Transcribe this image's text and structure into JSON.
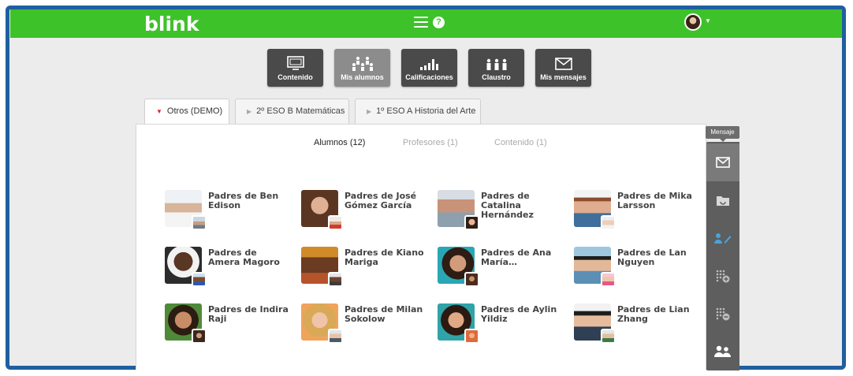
{
  "app": {
    "logo": "blink"
  },
  "nav": {
    "buttons": [
      {
        "label": "Contenido",
        "icon": "monitor-icon",
        "active": false
      },
      {
        "label": "Mis alumnos",
        "icon": "students-icon",
        "active": true
      },
      {
        "label": "Calificaciones",
        "icon": "bar-chart-icon",
        "active": false
      },
      {
        "label": "Claustro",
        "icon": "staff-icon",
        "active": false
      },
      {
        "label": "Mis mensajes",
        "icon": "envelope-icon",
        "active": false
      }
    ]
  },
  "class_tabs": [
    {
      "label": "Otros (DEMO)",
      "active": true
    },
    {
      "label": "2º ESO B Matemáticas",
      "active": false
    },
    {
      "label": "1º ESO A Historia del Arte",
      "active": false
    }
  ],
  "subtabs": [
    {
      "label": "Alumnos (12)",
      "active": true
    },
    {
      "label": "Profesores (1)",
      "active": false
    },
    {
      "label": "Contenido (1)",
      "active": false
    }
  ],
  "contacts": [
    {
      "name": "Padres de Ben Edison"
    },
    {
      "name": "Padres de José Gómez García"
    },
    {
      "name": "Padres de Catalina Hernández"
    },
    {
      "name": "Padres de Mika Larsson"
    },
    {
      "name": "Padres de Amera Magoro"
    },
    {
      "name": "Padres de Kiano Mariga"
    },
    {
      "name": "Padres de Ana María…"
    },
    {
      "name": "Padres de Lan Nguyen"
    },
    {
      "name": "Padres de Indira Raji"
    },
    {
      "name": "Padres de Milan Sokolow"
    },
    {
      "name": "Padres de Aylin Yildiz"
    },
    {
      "name": "Padres de Lian Zhang"
    }
  ],
  "sidebar": {
    "tooltip": "Mensaje",
    "buttons": [
      {
        "icon": "envelope-icon"
      },
      {
        "icon": "folder-icon"
      },
      {
        "icon": "user-edit-icon"
      },
      {
        "icon": "grid-add-icon"
      },
      {
        "icon": "grid-remove-icon"
      },
      {
        "icon": "group-icon"
      }
    ]
  },
  "colors": {
    "brand_green": "#3ec22a",
    "frame_blue": "#1f5fa0",
    "tab_marker_red": "#d9262e",
    "user_icon_blue": "#4aa3df"
  }
}
